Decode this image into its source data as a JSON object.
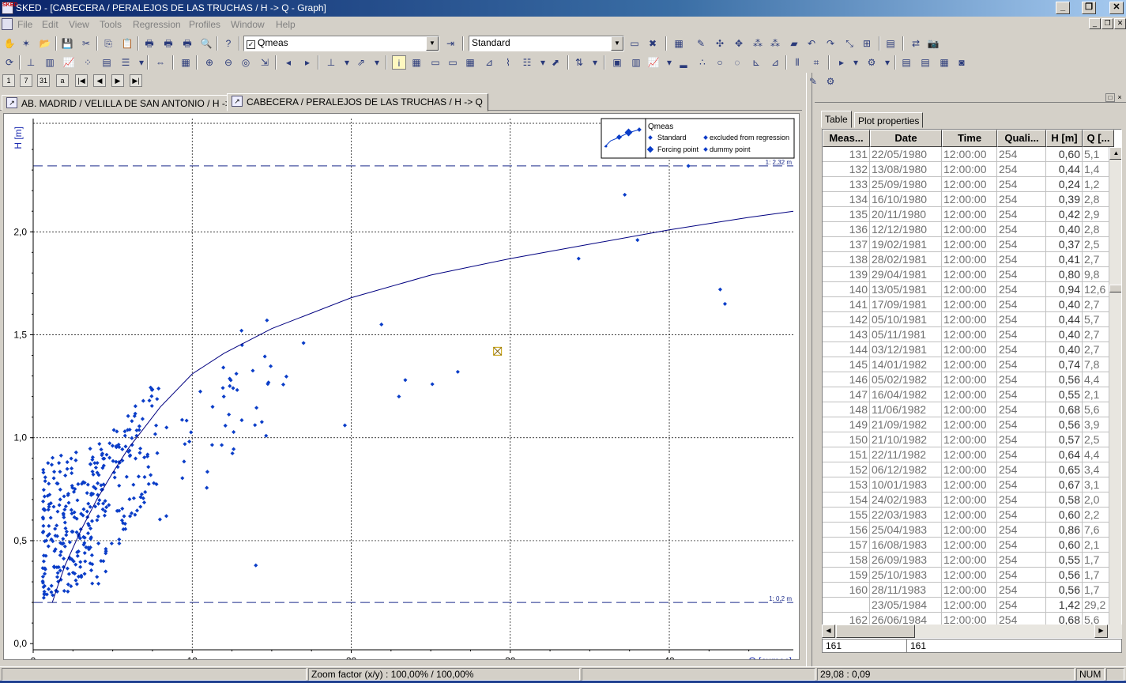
{
  "window": {
    "title": "SKED - [CABECERA / PERALEJOS DE LAS TRUCHAS / H -> Q - Graph]",
    "app_icon": "SKED"
  },
  "menu": [
    "File",
    "Edit",
    "View",
    "Tools",
    "Regression",
    "Profiles",
    "Window",
    "Help"
  ],
  "toolbar": {
    "series_select": "Qmeas",
    "series_checked": true,
    "style_select": "Standard"
  },
  "nav_buttons": [
    "1",
    "7",
    "31",
    "a"
  ],
  "doc_tabs": [
    {
      "label": "AB. MADRID / VELILLA DE SAN ANTONIO / H -> Q",
      "active": false
    },
    {
      "label": "CABECERA / PERALEJOS DE LAS TRUCHAS / H -> Q",
      "active": true
    }
  ],
  "chart_data": {
    "type": "scatter",
    "xlabel": "Q [cumec]",
    "ylabel": "H [m]",
    "xlim": [
      0,
      47.8
    ],
    "ylim": [
      -0.03,
      2.55
    ],
    "x_ticks": [
      0,
      10,
      20,
      30,
      40
    ],
    "y_ticks": [
      0.0,
      0.5,
      1.0,
      1.5,
      2.0
    ],
    "y_tick_labels": [
      "0,0",
      "0,5",
      "1,0",
      "1,5",
      "2,0"
    ],
    "grid": true,
    "legend": {
      "position": "top-right",
      "title": "Qmeas",
      "entries": [
        "Standard",
        "excluded from regression",
        "Forcing point",
        "dummy point"
      ]
    },
    "limit_lines": [
      {
        "y": 2.32,
        "label": "1: 2,32 m"
      },
      {
        "y": 0.2,
        "label": "1: 0,2 m"
      }
    ],
    "cursor_marker": {
      "x": 29.2,
      "y": 1.42
    },
    "curve": {
      "name": "rating curve",
      "x": [
        1.2,
        1.5,
        2,
        3,
        4,
        5,
        6,
        8,
        10,
        12,
        15,
        20,
        25,
        30,
        35,
        40,
        45,
        47.8
      ],
      "y": [
        0.2,
        0.27,
        0.38,
        0.55,
        0.7,
        0.83,
        0.95,
        1.15,
        1.31,
        1.41,
        1.53,
        1.68,
        1.79,
        1.87,
        1.94,
        2.01,
        2.07,
        2.1
      ]
    },
    "highlighted_points": [
      {
        "x": 37.2,
        "y": 2.18
      },
      {
        "x": 41.2,
        "y": 2.32
      },
      {
        "x": 34.3,
        "y": 1.87
      },
      {
        "x": 38.0,
        "y": 1.96
      },
      {
        "x": 43.2,
        "y": 1.72
      },
      {
        "x": 43.5,
        "y": 1.65
      },
      {
        "x": 21.9,
        "y": 1.55
      },
      {
        "x": 17.0,
        "y": 1.46
      },
      {
        "x": 14.7,
        "y": 1.57
      },
      {
        "x": 13.1,
        "y": 1.52
      },
      {
        "x": 14.0,
        "y": 0.38
      },
      {
        "x": 19.6,
        "y": 1.06
      },
      {
        "x": 26.7,
        "y": 1.32
      },
      {
        "x": 25.1,
        "y": 1.26
      },
      {
        "x": 23.4,
        "y": 1.28
      },
      {
        "x": 23.0,
        "y": 1.2
      }
    ],
    "cluster_points_note": "plus ~400 measured points densely scattered for Q between 0.5 and 16 cumec and H between 0.2 and 1.4 m"
  },
  "right_panel": {
    "tabs": [
      {
        "label": "Table",
        "active": true
      },
      {
        "label": "Plot properties",
        "active": false
      }
    ],
    "columns": [
      "Meas...",
      "Date",
      "Time",
      "Quali...",
      "H [m]",
      "Q [..."
    ],
    "rows": [
      [
        "131",
        "22/05/1980",
        "12:00:00",
        "254",
        "0,60",
        "5,1"
      ],
      [
        "132",
        "13/08/1980",
        "12:00:00",
        "254",
        "0,44",
        "1,4"
      ],
      [
        "133",
        "25/09/1980",
        "12:00:00",
        "254",
        "0,24",
        "1,2"
      ],
      [
        "134",
        "16/10/1980",
        "12:00:00",
        "254",
        "0,39",
        "2,8"
      ],
      [
        "135",
        "20/11/1980",
        "12:00:00",
        "254",
        "0,42",
        "2,9"
      ],
      [
        "136",
        "12/12/1980",
        "12:00:00",
        "254",
        "0,40",
        "2,8"
      ],
      [
        "137",
        "19/02/1981",
        "12:00:00",
        "254",
        "0,37",
        "2,5"
      ],
      [
        "138",
        "28/02/1981",
        "12:00:00",
        "254",
        "0,41",
        "2,7"
      ],
      [
        "139",
        "29/04/1981",
        "12:00:00",
        "254",
        "0,80",
        "9,8"
      ],
      [
        "140",
        "13/05/1981",
        "12:00:00",
        "254",
        "0,94",
        "12,6"
      ],
      [
        "141",
        "17/09/1981",
        "12:00:00",
        "254",
        "0,40",
        "2,7"
      ],
      [
        "142",
        "05/10/1981",
        "12:00:00",
        "254",
        "0,44",
        "5,7"
      ],
      [
        "143",
        "05/11/1981",
        "12:00:00",
        "254",
        "0,40",
        "2,7"
      ],
      [
        "144",
        "03/12/1981",
        "12:00:00",
        "254",
        "0,40",
        "2,7"
      ],
      [
        "145",
        "14/01/1982",
        "12:00:00",
        "254",
        "0,74",
        "7,8"
      ],
      [
        "146",
        "05/02/1982",
        "12:00:00",
        "254",
        "0,56",
        "4,4"
      ],
      [
        "147",
        "16/04/1982",
        "12:00:00",
        "254",
        "0,55",
        "2,1"
      ],
      [
        "148",
        "11/06/1982",
        "12:00:00",
        "254",
        "0,68",
        "5,6"
      ],
      [
        "149",
        "21/09/1982",
        "12:00:00",
        "254",
        "0,56",
        "3,9"
      ],
      [
        "150",
        "21/10/1982",
        "12:00:00",
        "254",
        "0,57",
        "2,5"
      ],
      [
        "151",
        "22/11/1982",
        "12:00:00",
        "254",
        "0,64",
        "4,4"
      ],
      [
        "152",
        "06/12/1982",
        "12:00:00",
        "254",
        "0,65",
        "3,4"
      ],
      [
        "153",
        "10/01/1983",
        "12:00:00",
        "254",
        "0,67",
        "3,1"
      ],
      [
        "154",
        "24/02/1983",
        "12:00:00",
        "254",
        "0,58",
        "2,0"
      ],
      [
        "155",
        "22/03/1983",
        "12:00:00",
        "254",
        "0,60",
        "2,2"
      ],
      [
        "156",
        "25/04/1983",
        "12:00:00",
        "254",
        "0,86",
        "7,6"
      ],
      [
        "157",
        "16/08/1983",
        "12:00:00",
        "254",
        "0,60",
        "2,1"
      ],
      [
        "158",
        "26/09/1983",
        "12:00:00",
        "254",
        "0,55",
        "1,7"
      ],
      [
        "159",
        "25/10/1983",
        "12:00:00",
        "254",
        "0,56",
        "1,7"
      ],
      [
        "160",
        "28/11/1983",
        "12:00:00",
        "254",
        "0,56",
        "1,7"
      ],
      [
        "161",
        "23/05/1984",
        "12:00:00",
        "254",
        "1,42",
        "29,2"
      ],
      [
        "162",
        "26/06/1984",
        "12:00:00",
        "254",
        "0,68",
        "5,6"
      ]
    ],
    "selected_row": "161",
    "footer_left": "161",
    "footer_right": "161"
  },
  "statusbar": {
    "zoom": "Zoom factor (x/y) :  100,00% / 100,00%",
    "coords": "29,08 : 0,09",
    "num": "NUM"
  },
  "colors": {
    "series": "#0a3dc8",
    "curve": "#000080",
    "limit": "#1a2a8a",
    "title_bg": "#0a246a"
  }
}
